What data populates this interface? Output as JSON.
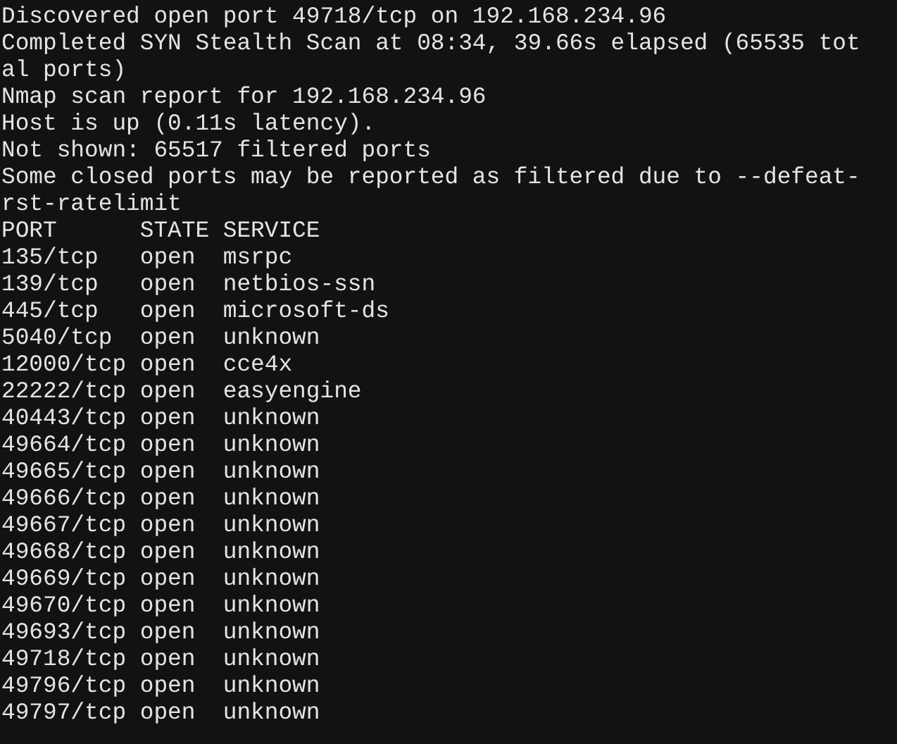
{
  "log_lines": [
    "Discovered open port 49718/tcp on 192.168.234.96",
    "Completed SYN Stealth Scan at 08:34, 39.66s elapsed (65535 tot",
    "al ports)",
    "Nmap scan report for 192.168.234.96",
    "Host is up (0.11s latency).",
    "Not shown: 65517 filtered ports",
    "Some closed ports may be reported as filtered due to --defeat-",
    "rst-ratelimit"
  ],
  "table": {
    "columns": [
      "PORT",
      "STATE",
      "SERVICE"
    ],
    "rows": [
      {
        "port": "135/tcp",
        "state": "open",
        "service": "msrpc"
      },
      {
        "port": "139/tcp",
        "state": "open",
        "service": "netbios-ssn"
      },
      {
        "port": "445/tcp",
        "state": "open",
        "service": "microsoft-ds"
      },
      {
        "port": "5040/tcp",
        "state": "open",
        "service": "unknown"
      },
      {
        "port": "12000/tcp",
        "state": "open",
        "service": "cce4x"
      },
      {
        "port": "22222/tcp",
        "state": "open",
        "service": "easyengine"
      },
      {
        "port": "40443/tcp",
        "state": "open",
        "service": "unknown"
      },
      {
        "port": "49664/tcp",
        "state": "open",
        "service": "unknown"
      },
      {
        "port": "49665/tcp",
        "state": "open",
        "service": "unknown"
      },
      {
        "port": "49666/tcp",
        "state": "open",
        "service": "unknown"
      },
      {
        "port": "49667/tcp",
        "state": "open",
        "service": "unknown"
      },
      {
        "port": "49668/tcp",
        "state": "open",
        "service": "unknown"
      },
      {
        "port": "49669/tcp",
        "state": "open",
        "service": "unknown"
      },
      {
        "port": "49670/tcp",
        "state": "open",
        "service": "unknown"
      },
      {
        "port": "49693/tcp",
        "state": "open",
        "service": "unknown"
      },
      {
        "port": "49718/tcp",
        "state": "open",
        "service": "unknown"
      },
      {
        "port": "49796/tcp",
        "state": "open",
        "service": "unknown"
      },
      {
        "port": "49797/tcp",
        "state": "open",
        "service": "unknown"
      }
    ]
  }
}
